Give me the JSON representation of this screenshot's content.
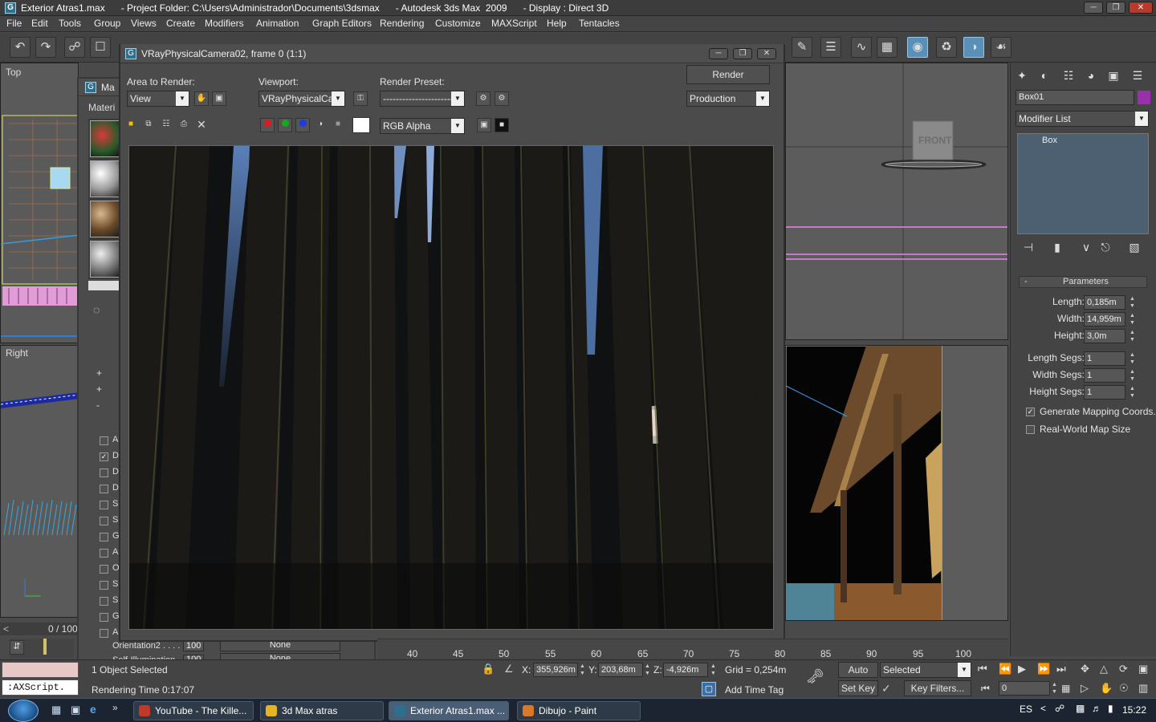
{
  "app": {
    "title": "Exterior Atras1.max      - Project Folder: C:\\Users\\Administrador\\Documents\\3dsmax      - Autodesk 3ds Max  2009      - Display : Direct 3D"
  },
  "menu": [
    "File",
    "Edit",
    "Tools",
    "Group",
    "Views",
    "Create",
    "Modifiers",
    "Animation",
    "Graph Editors",
    "Rendering",
    "Customize",
    "MAXScript",
    "Help",
    "Tentacles"
  ],
  "viewports": {
    "top": "Top",
    "right": "Right",
    "front": "FRONT"
  },
  "material_editor": {
    "title": "Ma",
    "menu": "Materi",
    "rows": [
      {
        "checked": false,
        "name": "A"
      },
      {
        "checked": true,
        "name": "D"
      },
      {
        "checked": false,
        "name": "D"
      },
      {
        "checked": false,
        "name": "D"
      },
      {
        "checked": false,
        "name": "S"
      },
      {
        "checked": false,
        "name": "S"
      },
      {
        "checked": false,
        "name": "G"
      },
      {
        "checked": false,
        "name": "A"
      },
      {
        "checked": false,
        "name": "O"
      },
      {
        "checked": false,
        "name": "S"
      },
      {
        "checked": false,
        "name": "S"
      },
      {
        "checked": false,
        "name": "G"
      },
      {
        "checked": false,
        "name": "A"
      }
    ],
    "orient_label": "Orientation2 . . . .",
    "orient_val": "100",
    "orient_none": "None",
    "selfillum_label": "Self-Illumination",
    "selfillum_val": "100",
    "selfillum_none": "None"
  },
  "render_frame": {
    "title": "VRayPhysicalCamera02, frame 0 (1:1)",
    "area_label": "Area to Render:",
    "area_value": "View",
    "viewport_label": "Viewport:",
    "viewport_value": "VRayPhysicalCam",
    "preset_label": "Render Preset:",
    "preset_value": "---------------------------",
    "render_button": "Render",
    "production_value": "Production",
    "channel_value": "RGB Alpha"
  },
  "command_panel": {
    "object_name": "Box01",
    "object_color": "#9b2fae",
    "modifier_list": "Modifier List",
    "stack_item": "Box",
    "rollout": "Parameters",
    "params": [
      {
        "label": "Length:",
        "value": "0,185m"
      },
      {
        "label": "Width:",
        "value": "14,959m"
      },
      {
        "label": "Height:",
        "value": "3,0m"
      },
      {
        "label": "Length Segs:",
        "value": "1"
      },
      {
        "label": "Width Segs:",
        "value": "1"
      },
      {
        "label": "Height Segs:",
        "value": "1"
      }
    ],
    "gen_mapping": "Generate Mapping Coords.",
    "gen_mapping_checked": true,
    "realworld": "Real-World Map Size",
    "realworld_checked": false
  },
  "timeline": {
    "counter": "0 / 100",
    "ticks": [
      "40",
      "45",
      "50",
      "55",
      "60",
      "65",
      "70",
      "75",
      "80",
      "85",
      "90",
      "95",
      "100"
    ]
  },
  "status": {
    "selected": "1 Object Selected",
    "render_time": "Rendering Time  0:17:07",
    "maxscript": ":AXScript.",
    "x_label": "X:",
    "x": "355,926m",
    "y_label": "Y:",
    "y": "203,68m",
    "z_label": "Z:",
    "z": "-4,926m",
    "grid": "Grid = 0,254m",
    "add_time_tag": "Add Time Tag",
    "auto_key": "Auto Key",
    "set_key": "Set Key",
    "selected_dd": "Selected",
    "key_filters": "Key Filters...",
    "frame": "0"
  },
  "taskbar": {
    "tasks": [
      {
        "label": "YouTube - The Kille...",
        "color": "#c0392b"
      },
      {
        "label": "3d Max atras",
        "color": "#e6b422"
      },
      {
        "label": "Exterior Atras1.max ...",
        "color": "#2f6f8e"
      },
      {
        "label": "Dibujo - Paint",
        "color": "#d9772b"
      }
    ],
    "lang": "ES",
    "clock": "15:22"
  }
}
